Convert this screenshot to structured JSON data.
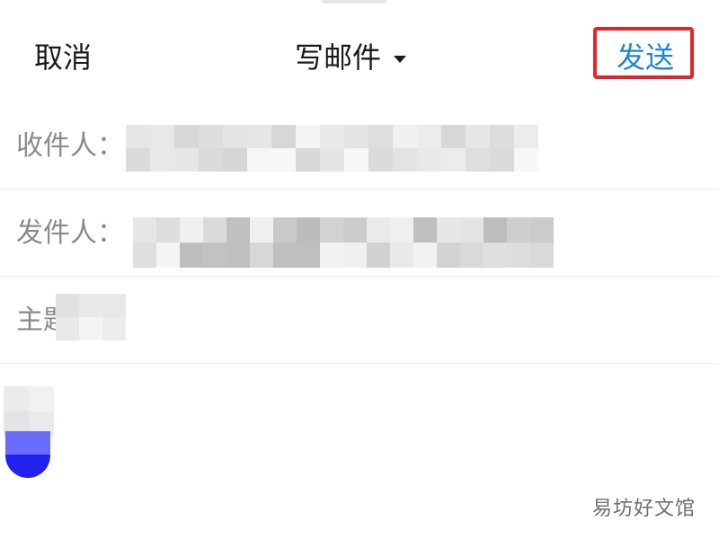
{
  "nav": {
    "cancel_label": "取消",
    "title": "写邮件",
    "send_label": "发送",
    "highlight_color": "#e3252b",
    "send_color": "#1f86d6"
  },
  "fields": {
    "to_label": "收件人：",
    "from_label": "发件人：",
    "subject_label": "主题"
  },
  "watermark": "易坊好文馆"
}
